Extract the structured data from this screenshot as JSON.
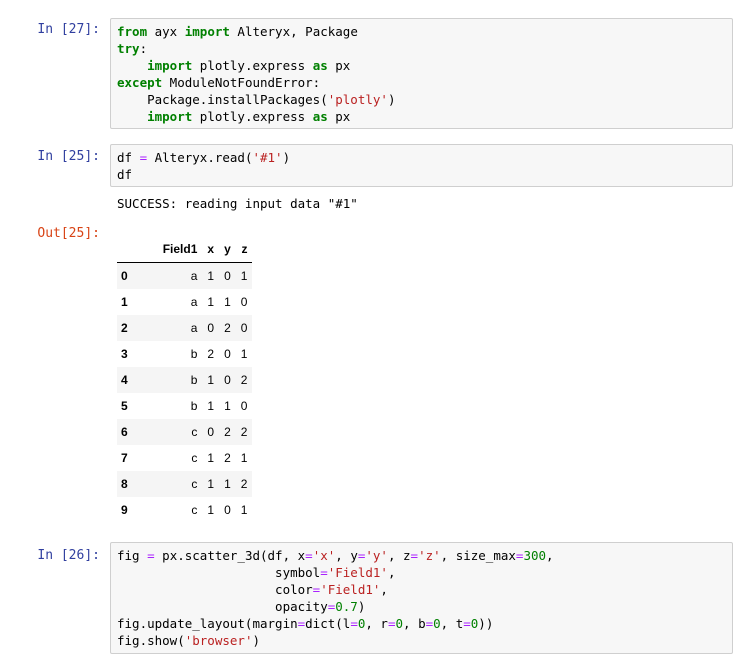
{
  "cell27": {
    "prompt": "In [27]:",
    "lines": [
      [
        [
          "kw",
          "from"
        ],
        [
          "nm",
          " ayx "
        ],
        [
          "kw",
          "import"
        ],
        [
          "nm",
          " Alteryx, Package"
        ]
      ],
      [
        [
          "kw",
          "try"
        ],
        [
          "nm",
          ":"
        ]
      ],
      [
        [
          "nm",
          "    "
        ],
        [
          "kw",
          "import"
        ],
        [
          "nm",
          " plotly.express "
        ],
        [
          "kw",
          "as"
        ],
        [
          "nm",
          " px"
        ]
      ],
      [
        [
          "kw",
          "except"
        ],
        [
          "nm",
          " ModuleNotFoundError:"
        ]
      ],
      [
        [
          "nm",
          "    Package.installPackages("
        ],
        [
          "str",
          "'plotly'"
        ],
        [
          "nm",
          ")"
        ]
      ],
      [
        [
          "nm",
          "    "
        ],
        [
          "kw",
          "import"
        ],
        [
          "nm",
          " plotly.express "
        ],
        [
          "kw",
          "as"
        ],
        [
          "nm",
          " px"
        ]
      ]
    ]
  },
  "cell25": {
    "prompt": "In [25]:",
    "lines": [
      [
        [
          "nm",
          "df "
        ],
        [
          "op",
          "="
        ],
        [
          "nm",
          " Alteryx.read("
        ],
        [
          "str",
          "'#1'"
        ],
        [
          "nm",
          ")"
        ]
      ],
      [
        [
          "nm",
          "df"
        ]
      ]
    ],
    "stream": "SUCCESS: reading input data \"#1\"",
    "out_prompt": "Out[25]:"
  },
  "dataframe": {
    "columns": [
      "",
      "Field1",
      "x",
      "y",
      "z"
    ],
    "rows": [
      [
        "0",
        "a",
        "1",
        "0",
        "1"
      ],
      [
        "1",
        "a",
        "1",
        "1",
        "0"
      ],
      [
        "2",
        "a",
        "0",
        "2",
        "0"
      ],
      [
        "3",
        "b",
        "2",
        "0",
        "1"
      ],
      [
        "4",
        "b",
        "1",
        "0",
        "2"
      ],
      [
        "5",
        "b",
        "1",
        "1",
        "0"
      ],
      [
        "6",
        "c",
        "0",
        "2",
        "2"
      ],
      [
        "7",
        "c",
        "1",
        "2",
        "1"
      ],
      [
        "8",
        "c",
        "1",
        "1",
        "2"
      ],
      [
        "9",
        "c",
        "1",
        "0",
        "1"
      ]
    ]
  },
  "cell26": {
    "prompt": "In [26]:",
    "lines": [
      [
        [
          "nm",
          "fig "
        ],
        [
          "op",
          "="
        ],
        [
          "nm",
          " px.scatter_3d(df, x"
        ],
        [
          "op",
          "="
        ],
        [
          "str",
          "'x'"
        ],
        [
          "nm",
          ", y"
        ],
        [
          "op",
          "="
        ],
        [
          "str",
          "'y'"
        ],
        [
          "nm",
          ", z"
        ],
        [
          "op",
          "="
        ],
        [
          "str",
          "'z'"
        ],
        [
          "nm",
          ", size_max"
        ],
        [
          "op",
          "="
        ],
        [
          "num",
          "300"
        ],
        [
          "nm",
          ","
        ]
      ],
      [
        [
          "nm",
          "                     symbol"
        ],
        [
          "op",
          "="
        ],
        [
          "str",
          "'Field1'"
        ],
        [
          "nm",
          ","
        ]
      ],
      [
        [
          "nm",
          "                     color"
        ],
        [
          "op",
          "="
        ],
        [
          "str",
          "'Field1'"
        ],
        [
          "nm",
          ","
        ]
      ],
      [
        [
          "nm",
          "                     opacity"
        ],
        [
          "op",
          "="
        ],
        [
          "num",
          "0.7"
        ],
        [
          "nm",
          ")"
        ]
      ],
      [
        [
          "nm",
          "fig.update_layout(margin"
        ],
        [
          "op",
          "="
        ],
        [
          "nm",
          "dict(l"
        ],
        [
          "op",
          "="
        ],
        [
          "num",
          "0"
        ],
        [
          "nm",
          ", r"
        ],
        [
          "op",
          "="
        ],
        [
          "num",
          "0"
        ],
        [
          "nm",
          ", b"
        ],
        [
          "op",
          "="
        ],
        [
          "num",
          "0"
        ],
        [
          "nm",
          ", t"
        ],
        [
          "op",
          "="
        ],
        [
          "num",
          "0"
        ],
        [
          "nm",
          "))"
        ]
      ],
      [
        [
          "nm",
          "fig.show("
        ],
        [
          "str",
          "'browser'"
        ],
        [
          "nm",
          ")"
        ]
      ]
    ]
  }
}
